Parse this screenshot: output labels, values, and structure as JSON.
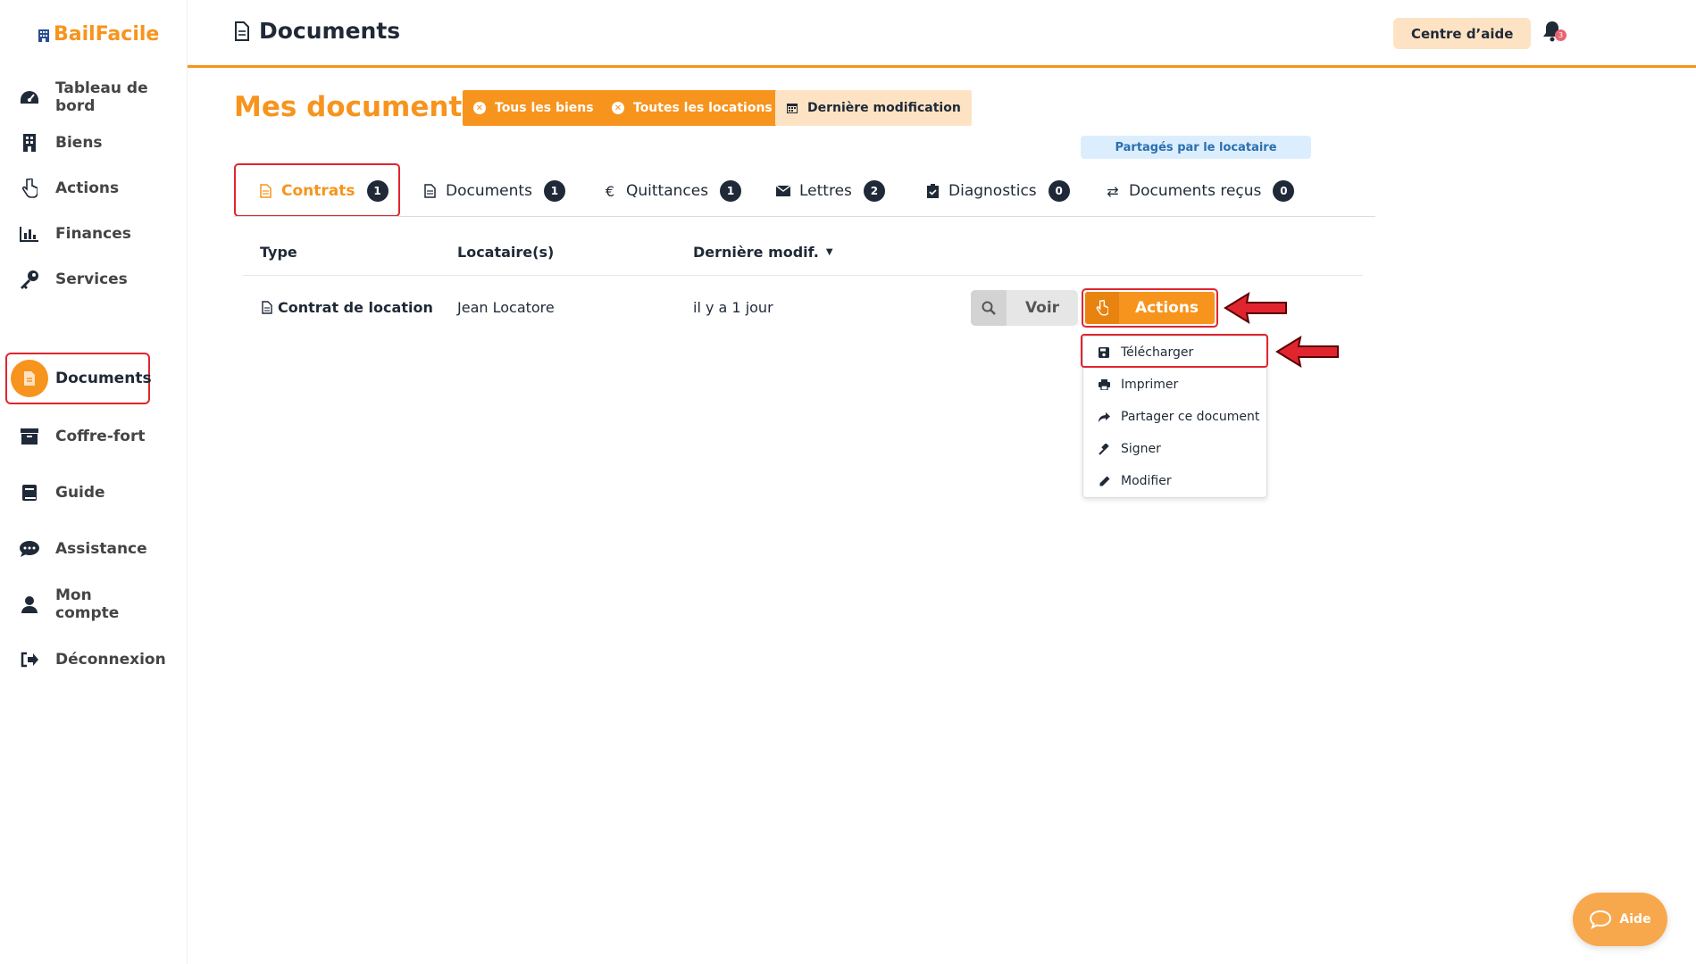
{
  "app": {
    "logo_text": "BailFacile"
  },
  "sidebar": {
    "items": [
      {
        "label": "Tableau de bord",
        "icon": "dashboard-icon"
      },
      {
        "label": "Biens",
        "icon": "building-icon"
      },
      {
        "label": "Actions",
        "icon": "hand-pointer-icon"
      },
      {
        "label": "Finances",
        "icon": "bar-chart-icon"
      },
      {
        "label": "Services",
        "icon": "key-icon"
      },
      {
        "label": "Documents",
        "icon": "document-icon",
        "active": true
      },
      {
        "label": "Coffre-fort",
        "icon": "archive-icon"
      },
      {
        "label": "Guide",
        "icon": "book-icon"
      },
      {
        "label": "Assistance",
        "icon": "chat-icon"
      },
      {
        "label": "Mon compte",
        "icon": "user-icon"
      },
      {
        "label": "Déconnexion",
        "icon": "sign-out-icon"
      }
    ]
  },
  "header": {
    "title": "Documents",
    "help_center": "Centre d’aide",
    "notifications_count": "3"
  },
  "main": {
    "heading": "Mes documents",
    "filters": [
      {
        "label": "Tous les biens"
      },
      {
        "label": "Toutes les locations"
      },
      {
        "label": "Dernière modification"
      }
    ],
    "shared_badge": "Partagés par le locataire",
    "tabs": [
      {
        "label": "Contrats",
        "count": "1",
        "icon": "file-icon",
        "active": true
      },
      {
        "label": "Documents",
        "count": "1",
        "icon": "file-icon"
      },
      {
        "label": "Quittances",
        "count": "1",
        "icon": "euro-icon"
      },
      {
        "label": "Lettres",
        "count": "2",
        "icon": "envelope-icon"
      },
      {
        "label": "Diagnostics",
        "count": "0",
        "icon": "clipboard-check-icon"
      },
      {
        "label": "Documents reçus",
        "count": "0",
        "icon": "exchange-icon"
      }
    ],
    "table": {
      "headers": [
        "Type",
        "Locataire(s)",
        "Dernière modif."
      ],
      "rows": [
        {
          "type": "Contrat de location",
          "tenant": "Jean Locatore",
          "modified": "il y a 1 jour"
        }
      ],
      "view_button": "Voir",
      "actions_button": "Actions"
    },
    "actions_menu": [
      {
        "label": "Télécharger",
        "icon": "save-icon"
      },
      {
        "label": "Imprimer",
        "icon": "print-icon"
      },
      {
        "label": "Partager ce document",
        "icon": "share-icon"
      },
      {
        "label": "Signer",
        "icon": "gavel-icon"
      },
      {
        "label": "Modifier",
        "icon": "pencil-icon"
      }
    ]
  },
  "help_widget": {
    "label": "Aide"
  },
  "colors": {
    "accent": "#f7941d",
    "annotation": "#e0252e",
    "dark": "#1f2937"
  }
}
